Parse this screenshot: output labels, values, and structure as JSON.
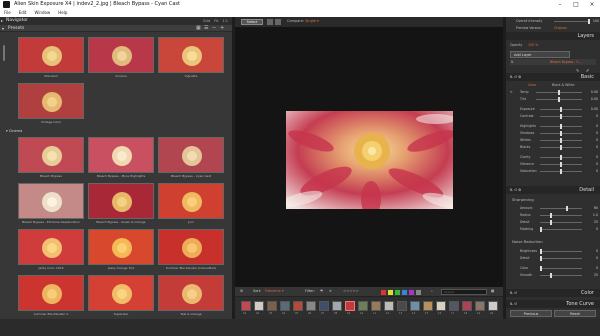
{
  "window": {
    "title": "Alien Skin Exposure X4 | indev2_2.jpg | Bleach Bypass - Cyan Cast"
  },
  "menu": [
    "File",
    "Edit",
    "Window",
    "Help"
  ],
  "navigator": {
    "title": "Navigator",
    "actions": [
      "Grid",
      "Fit",
      "1:1"
    ]
  },
  "presets": {
    "title": "Presets",
    "row0": [
      {
        "label": "Standard"
      },
      {
        "label": "Cinema"
      },
      {
        "label": "Vignette"
      }
    ],
    "row1": [
      {
        "label": "Vintage Color"
      }
    ],
    "section_cinema": "Cinema",
    "cinema": [
      {
        "label": "Bleach Bypass"
      },
      {
        "label": "Bleach Bypass - More Highlights"
      },
      {
        "label": "Bleach Bypass - Cyan Cast"
      },
      {
        "label": "Bleach Bypass - Extreme Desaturation"
      },
      {
        "label": "Bleach Bypass - Green & Orange"
      },
      {
        "label": "Jovi"
      },
      {
        "label": "Jazzy Color 2016"
      },
      {
        "label": "Jazzy Orange Tint"
      },
      {
        "label": "Summer Blockbuster (Intensified)"
      },
      {
        "label": "Summer Blockbuster 2"
      },
      {
        "label": "Superstar"
      },
      {
        "label": "Teal & Orange"
      }
    ]
  },
  "center": {
    "view_tab": "Select",
    "compare_label": "Compare:",
    "compare_value": "Single ▾",
    "toolbar": {
      "sort_label": "Sort:",
      "sort_value": "Filename ▾",
      "filter_label": "Filter:",
      "stars": "☆☆☆☆☆",
      "search_placeholder": "Search"
    },
    "filmstrip": [
      "01",
      "02",
      "03",
      "04",
      "05",
      "06",
      "07",
      "08",
      "09",
      "10",
      "11",
      "12",
      "13",
      "14",
      "15",
      "16",
      "17",
      "18",
      "19",
      "20"
    ]
  },
  "right": {
    "overall_intensity_label": "Overall Intensity",
    "overall_intensity_value": "100",
    "preview_label": "Preview Version",
    "preview_value": "Original",
    "layers_title": "Layers",
    "opacity_label": "Opacity",
    "opacity_value": "100 %",
    "add_layer_label": "Add Layer",
    "layer_name": "Bleach Bypass - C...",
    "basic_title": "Basic",
    "color_tab": "Color",
    "bw_tab": "Black & White",
    "temp_label": "Temp",
    "tint_label": "Tint",
    "exposure_label": "Exposure",
    "contrast_label": "Contrast",
    "highlights_label": "Highlights",
    "shadows_label": "Shadows",
    "whites_label": "Whites",
    "blacks_label": "Blacks",
    "clarity_label": "Clarity",
    "vibrance_label": "Vibrance",
    "saturation_label": "Saturation",
    "temp_value": "0.00",
    "tint_value": "0.00",
    "exposure_value": "0.00",
    "contrast_value": "0",
    "highlights_value": "0",
    "shadows_value": "0",
    "whites_value": "0",
    "blacks_value": "0",
    "clarity_value": "0",
    "vibrance_value": "0",
    "saturation_value": "0",
    "detail_title": "Detail",
    "sharpening_label": "Sharpening",
    "amount_label": "Amount",
    "radius_label": "Radius",
    "detail_label": "Detail",
    "masking_label": "Masking",
    "amount_value": "60",
    "radius_value": "1.0",
    "detail_value": "25",
    "masking_value": "0",
    "noise_label": "Noise Reduction",
    "brightness_label": "Brightness",
    "ndetail_label": "Detail",
    "ncolor_label": "Color",
    "smooth_label": "Smooth",
    "brightness_value": "0",
    "ndetail_value": "0",
    "ncolor_value": "0",
    "smooth_value": "25",
    "color_panel_title": "Color",
    "tone_curve_title": "Tone Curve",
    "previous_button": "Previous",
    "reset_button": "Reset"
  }
}
